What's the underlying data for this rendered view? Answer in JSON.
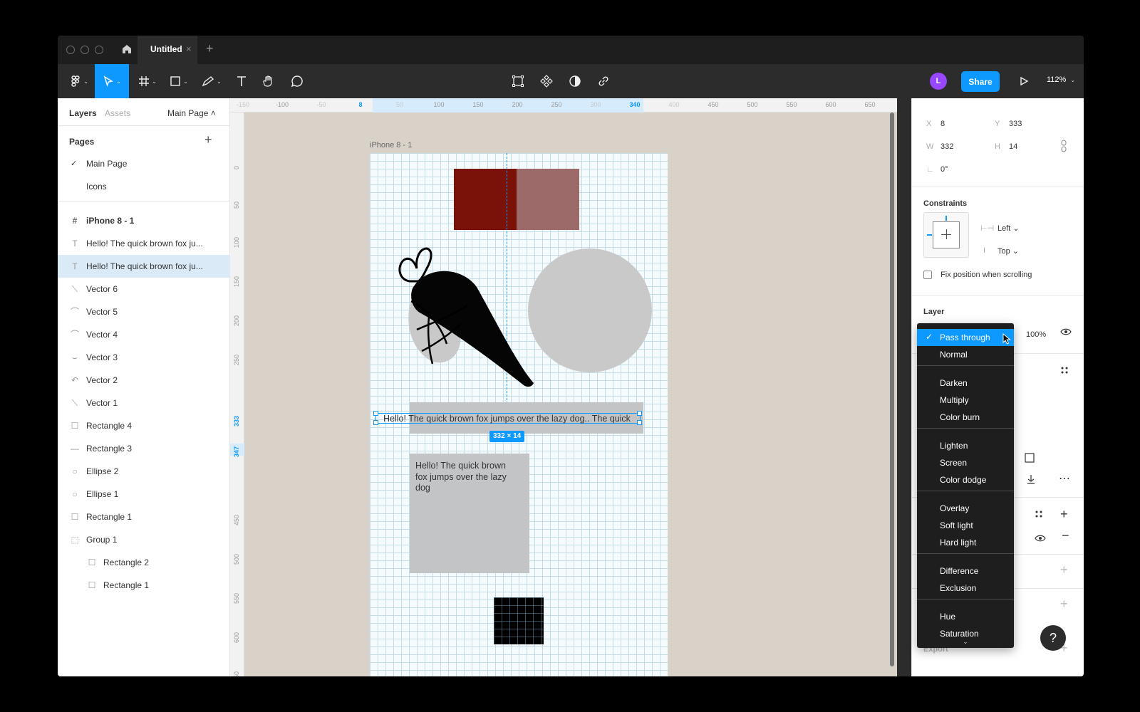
{
  "window": {
    "tab_title": "Untitled",
    "tab_close": "×",
    "new_tab": "+"
  },
  "toolbar": {
    "avatar_initial": "L",
    "share_label": "Share",
    "zoom": "112%",
    "caret": "⌄",
    "accent": "#0d99ff"
  },
  "left_panel": {
    "tabs": [
      "Layers",
      "Assets"
    ],
    "page_switch": "Main Page ˄",
    "pages_title": "Pages",
    "add_page": "+",
    "pages": [
      {
        "check": "✓",
        "label": "Main Page"
      },
      {
        "check": "",
        "label": "Icons"
      }
    ],
    "frame_icon": "#",
    "frame_name": "iPhone 8 - 1",
    "layers": [
      {
        "icon": "T",
        "label": "Hello! The quick brown fox ju...",
        "icon_name": "text-icon"
      },
      {
        "icon": "T",
        "label": "Hello! The quick brown fox ju...",
        "icon_name": "text-icon"
      },
      {
        "icon": "⟍",
        "label": "Vector 6",
        "icon_name": "vector-icon"
      },
      {
        "icon": "⌒",
        "label": "Vector 5",
        "icon_name": "vector-icon"
      },
      {
        "icon": "⌒",
        "label": "Vector 4",
        "icon_name": "vector-icon"
      },
      {
        "icon": "⌣",
        "label": "Vector 3",
        "icon_name": "vector-icon"
      },
      {
        "icon": "↶",
        "label": "Vector 2",
        "icon_name": "vector-icon"
      },
      {
        "icon": "⟍",
        "label": "Vector 1",
        "icon_name": "vector-icon"
      },
      {
        "icon": "☐",
        "label": "Rectangle 4",
        "icon_name": "rectangle-icon"
      },
      {
        "icon": "—",
        "label": "Rectangle 3",
        "icon_name": "line-icon"
      },
      {
        "icon": "○",
        "label": "Ellipse 2",
        "icon_name": "ellipse-icon"
      },
      {
        "icon": "○",
        "label": "Ellipse 1",
        "icon_name": "ellipse-icon"
      },
      {
        "icon": "☐",
        "label": "Rectangle 1",
        "icon_name": "rectangle-icon"
      },
      {
        "icon": "⬚",
        "label": "Group 1",
        "icon_name": "group-icon"
      },
      {
        "icon": "☐",
        "label": "Rectangle 2",
        "icon_name": "rectangle-icon"
      },
      {
        "icon": "☐",
        "label": "Rectangle 1",
        "icon_name": "rectangle-icon"
      }
    ]
  },
  "rulers": {
    "top_ticks": [
      {
        "label": "-150",
        "style": "faint"
      },
      {
        "label": "-100",
        "style": ""
      },
      {
        "label": "-50",
        "style": "faint"
      },
      {
        "label": "8",
        "style": "hi"
      },
      {
        "label": "50",
        "style": "faint"
      },
      {
        "label": "100",
        "style": ""
      },
      {
        "label": "150",
        "style": ""
      },
      {
        "label": "200",
        "style": ""
      },
      {
        "label": "250",
        "style": ""
      },
      {
        "label": "300",
        "style": "faint"
      },
      {
        "label": "340",
        "style": "hi"
      },
      {
        "label": "400",
        "style": "faint"
      },
      {
        "label": "450",
        "style": ""
      },
      {
        "label": "500",
        "style": ""
      },
      {
        "label": "550",
        "style": ""
      },
      {
        "label": "600",
        "style": ""
      },
      {
        "label": "650",
        "style": ""
      }
    ],
    "left_ticks": [
      {
        "label": "0",
        "style": ""
      },
      {
        "label": "50",
        "style": ""
      },
      {
        "label": "100",
        "style": ""
      },
      {
        "label": "150",
        "style": ""
      },
      {
        "label": "200",
        "style": ""
      },
      {
        "label": "250",
        "style": ""
      },
      {
        "label": "333",
        "style": "hi"
      },
      {
        "label": "347",
        "style": "hi"
      },
      {
        "label": "450",
        "style": ""
      },
      {
        "label": "500",
        "style": ""
      },
      {
        "label": "550",
        "style": ""
      },
      {
        "label": "600",
        "style": ""
      },
      {
        "label": "650",
        "style": ""
      }
    ]
  },
  "canvas": {
    "frame_label": "iPhone 8 - 1",
    "selected_text": "Hello! The quick brown fox jumps over the lazy dog.. The quick",
    "dimension_badge": "332 × 14",
    "paragraph_text": "Hello! The quick brown fox jumps over the lazy dog",
    "colors": {
      "dark_red": "#7a1208",
      "muted_red": "#9c6b69",
      "grey": "#c2c4c5",
      "black": "#000000"
    }
  },
  "right_panel": {
    "x_label": "X",
    "x_value": "8",
    "y_label": "Y",
    "y_value": "333",
    "w_label": "W",
    "w_value": "332",
    "h_label": "H",
    "h_value": "14",
    "rotation_icon": "∟",
    "rotation_value": "0°",
    "constraints_title": "Constraints",
    "horizontal_icon": "⊢⊣",
    "horizontal_constraint": "Left ⌄",
    "vertical_icon": "I",
    "vertical_constraint": "Top ⌄",
    "fix_position_label": "Fix position when scrolling",
    "layer_title": "Layer",
    "opacity": "100%",
    "export_title": "Export",
    "help": "?"
  },
  "blend_dropdown": {
    "selected": "Pass through",
    "check": "✓",
    "more": "⌄",
    "groups": [
      [
        "Pass through",
        "Normal"
      ],
      [
        "Darken",
        "Multiply",
        "Color burn"
      ],
      [
        "Lighten",
        "Screen",
        "Color dodge"
      ],
      [
        "Overlay",
        "Soft light",
        "Hard light"
      ],
      [
        "Difference",
        "Exclusion"
      ],
      [
        "Hue",
        "Saturation"
      ]
    ]
  }
}
